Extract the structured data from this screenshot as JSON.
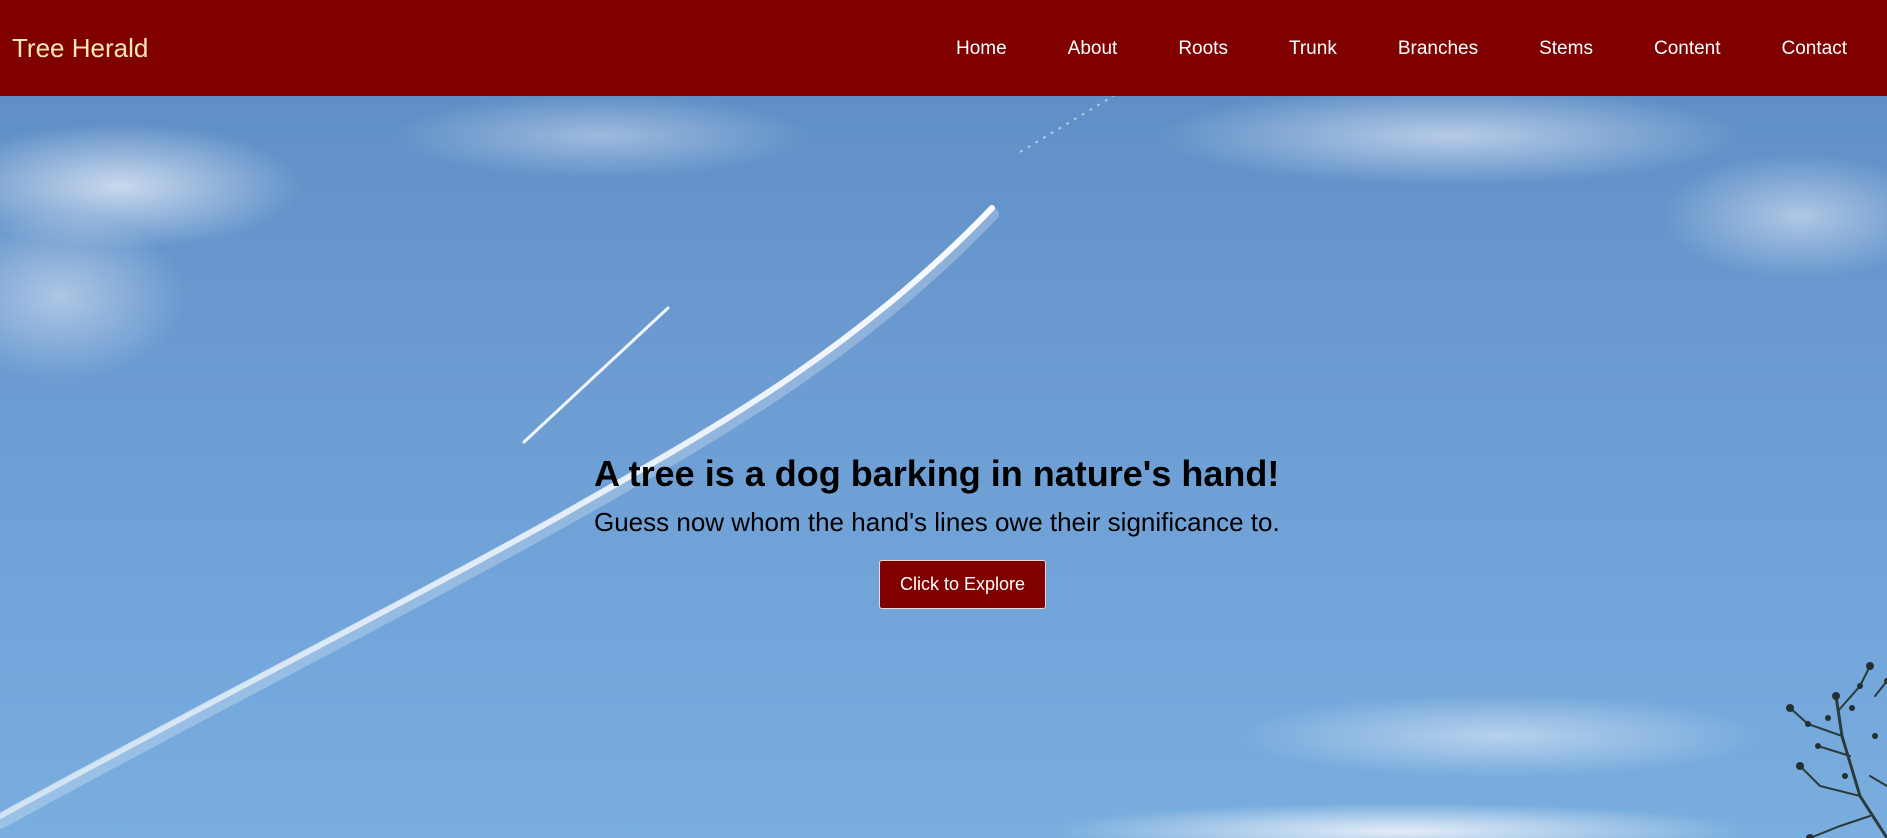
{
  "navbar": {
    "brand": "Tree Herald",
    "links": [
      "Home",
      "About",
      "Roots",
      "Trunk",
      "Branches",
      "Stems",
      "Content",
      "Contact"
    ]
  },
  "hero": {
    "title": "A tree is a dog barking in nature's hand!",
    "subtitle": "Guess now whom the hand's lines owe their significance to.",
    "cta_label": "Click to Explore"
  },
  "colors": {
    "navbar_bg": "#800000",
    "brand_text": "#f6e7b5",
    "button_bg": "#800000",
    "sky": "#6fa3d6"
  }
}
